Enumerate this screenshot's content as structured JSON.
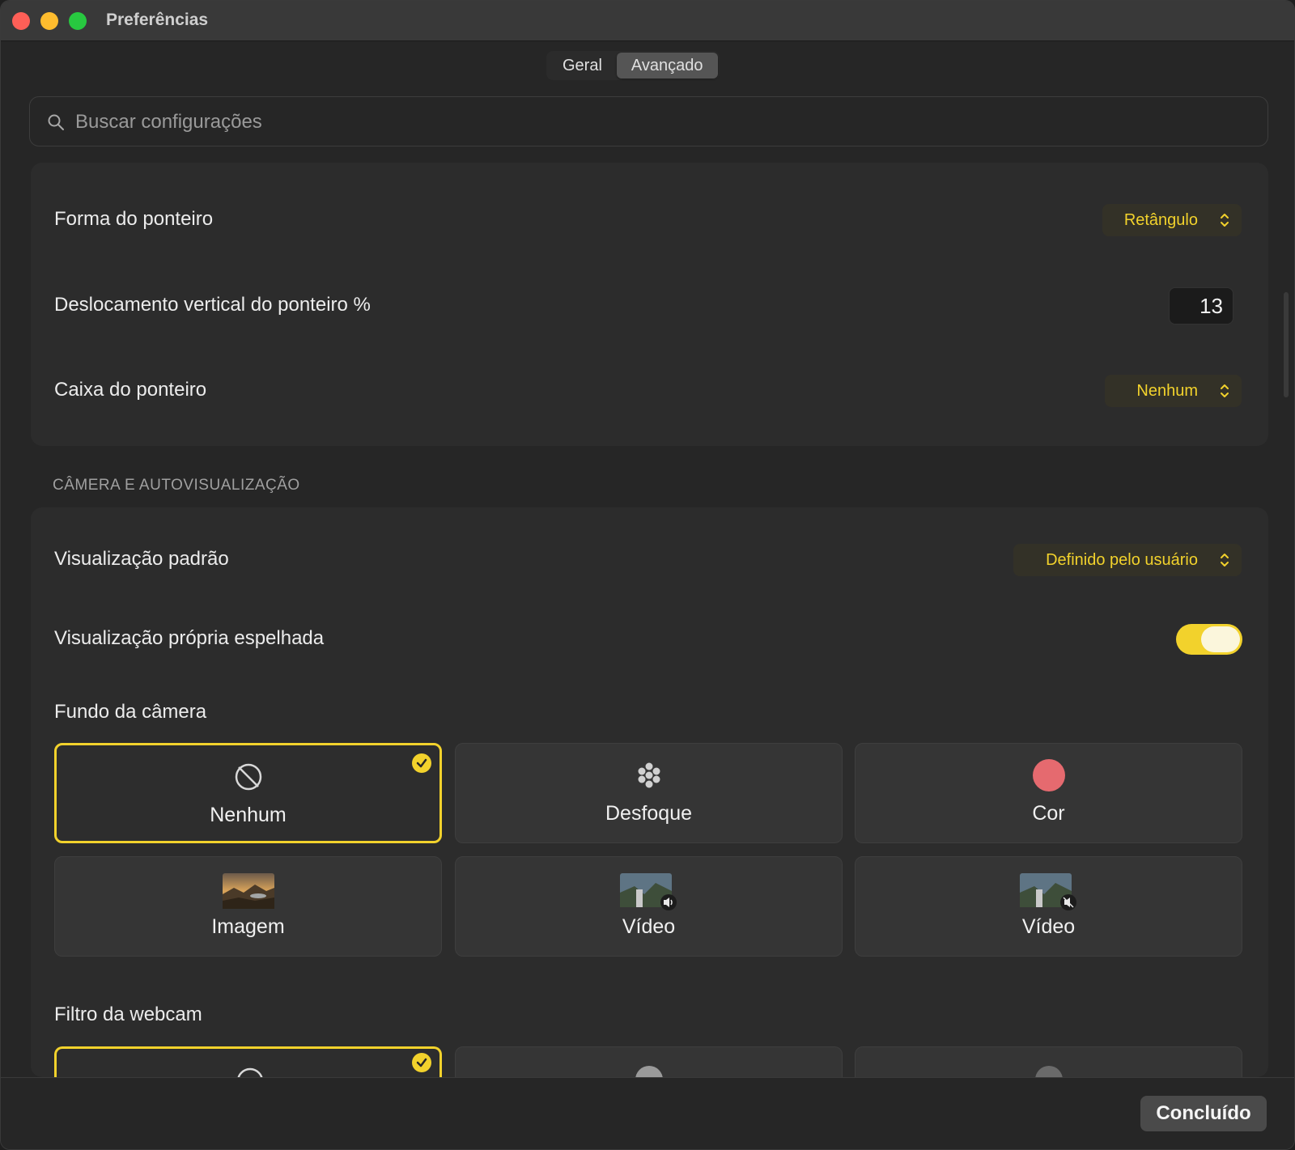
{
  "window": {
    "title": "Preferências"
  },
  "tabs": [
    {
      "label": "Geral",
      "active": false
    },
    {
      "label": "Avançado",
      "active": true
    }
  ],
  "search": {
    "placeholder": "Buscar configurações",
    "value": ""
  },
  "pointer": {
    "shape": {
      "label": "Forma do ponteiro",
      "value": "Retângulo"
    },
    "vertical_offset": {
      "label": "Deslocamento vertical do ponteiro %",
      "value": "13"
    },
    "box": {
      "label": "Caixa do ponteiro",
      "value": "Nenhum"
    }
  },
  "camera": {
    "section_title": "CÂMERA E AUTOVISUALIZAÇÃO",
    "default_view": {
      "label": "Visualização padrão",
      "value": "Definido pelo usuário"
    },
    "mirrored": {
      "label": "Visualização própria espelhada",
      "on": true
    },
    "background": {
      "label": "Fundo da câmera",
      "options": [
        {
          "label": "Nenhum",
          "icon": "no-background-icon",
          "selected": true
        },
        {
          "label": "Desfoque",
          "icon": "blur-icon",
          "selected": false
        },
        {
          "label": "Cor",
          "icon": "color-swatch-icon",
          "color": "#e56a6f",
          "selected": false
        },
        {
          "label": "Imagem",
          "icon": "landscape-image-icon",
          "selected": false
        },
        {
          "label": "Vídeo",
          "icon": "video-sound-on-icon",
          "selected": false
        },
        {
          "label": "Vídeo",
          "icon": "video-sound-off-icon",
          "selected": false
        }
      ]
    },
    "webcam_filter": {
      "label": "Filtro da webcam"
    }
  },
  "footer": {
    "done_label": "Concluído"
  },
  "colors": {
    "accent": "#f2d22c",
    "background": "#262626",
    "card": "#2c2c2c"
  }
}
